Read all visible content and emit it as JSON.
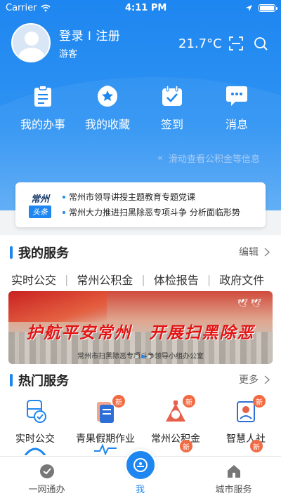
{
  "status_bar": {
    "carrier": "Carrier",
    "time": "4:11 PM"
  },
  "profile": {
    "login_label": "登录 I 注册",
    "guest_label": "游客"
  },
  "weather": {
    "temperature": "21.7°C"
  },
  "quick_actions": [
    {
      "label": "我的办事",
      "icon": "clipboard-icon"
    },
    {
      "label": "我的收藏",
      "icon": "star-icon"
    },
    {
      "label": "签到",
      "icon": "calendar-check-icon"
    },
    {
      "label": "消息",
      "icon": "chat-icon"
    }
  ],
  "slide_hint": {
    "arrows": "«",
    "text": "滑动查看公积金等信息"
  },
  "headline": {
    "logo_top": "常州",
    "logo_bottom": "头条",
    "items": [
      "常州市领导讲授主题教育专题党课",
      "常州大力推进扫黑除恶专项斗争 分析面临形势"
    ]
  },
  "my_services": {
    "title": "我的服务",
    "edit_label": "编辑",
    "tags": [
      "实时公交",
      "常州公积金",
      "体检报告",
      "政府文件"
    ]
  },
  "banner": {
    "slogan": "护航平安常州　开展扫黑除恶",
    "org": "常州市扫黑除恶专项斗争领导小组办公室"
  },
  "hot_services": {
    "title": "热门服务",
    "more_label": "更多",
    "badge_label": "新",
    "items": [
      {
        "label": "实时公交",
        "icon": "bus-icon",
        "new": false
      },
      {
        "label": "青果假期作业",
        "icon": "homework-icon",
        "new": true
      },
      {
        "label": "常州公积金",
        "icon": "housing-fund-icon",
        "new": true
      },
      {
        "label": "智慧人社",
        "icon": "social-security-icon",
        "new": true
      }
    ]
  },
  "tab_bar": {
    "tabs": [
      {
        "label": "一网通办",
        "icon": "check-circle-icon"
      },
      {
        "label": "我",
        "icon": "user-face-icon"
      },
      {
        "label": "城市服务",
        "icon": "house-icon"
      }
    ]
  },
  "colors": {
    "primary": "#1e86f0",
    "badge": "#f26a41",
    "slogan": "#e31414"
  }
}
